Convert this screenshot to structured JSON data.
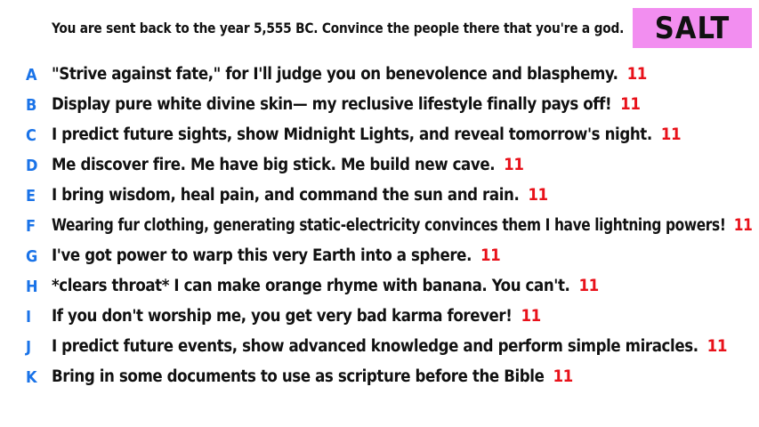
{
  "prompt": "You are sent back to the year 5,555 BC. Convince the people there that you're a god.",
  "brand": {
    "label": "SALT",
    "background": "#f28ef0",
    "color": "#111111"
  },
  "colors": {
    "letter": "#1a73e8",
    "score": "#e8111a",
    "text": "#111111"
  },
  "answers": [
    {
      "letter": "A",
      "text": "\"Strive against fate,\" for I'll judge you on benevolence and blasphemy.",
      "score": "11"
    },
    {
      "letter": "B",
      "text": "Display pure white divine skin— my reclusive lifestyle finally pays off!",
      "score": "11"
    },
    {
      "letter": "C",
      "text": "I predict future sights, show Midnight Lights, and reveal tomorrow's night.",
      "score": "11"
    },
    {
      "letter": "D",
      "text": "Me discover fire. Me have big stick. Me build new cave.",
      "score": "11"
    },
    {
      "letter": "E",
      "text": "I bring wisdom, heal pain, and command the sun and rain.",
      "score": "11"
    },
    {
      "letter": "F",
      "text": "Wearing fur clothing, generating static-electricity convinces them I have lightning powers!",
      "score": "11"
    },
    {
      "letter": "G",
      "text": "I've got power to warp this very Earth into a sphere.",
      "score": "11"
    },
    {
      "letter": "H",
      "text": "*clears throat* I can make orange rhyme with banana. You can't.",
      "score": "11"
    },
    {
      "letter": "I",
      "text": "If you don't worship me, you get very bad karma forever!",
      "score": "11"
    },
    {
      "letter": "J",
      "text": "I predict future events, show advanced knowledge and perform simple miracles.",
      "score": "11"
    },
    {
      "letter": "K",
      "text": "Bring in some documents to use as scripture before the Bible",
      "score": "11"
    }
  ]
}
